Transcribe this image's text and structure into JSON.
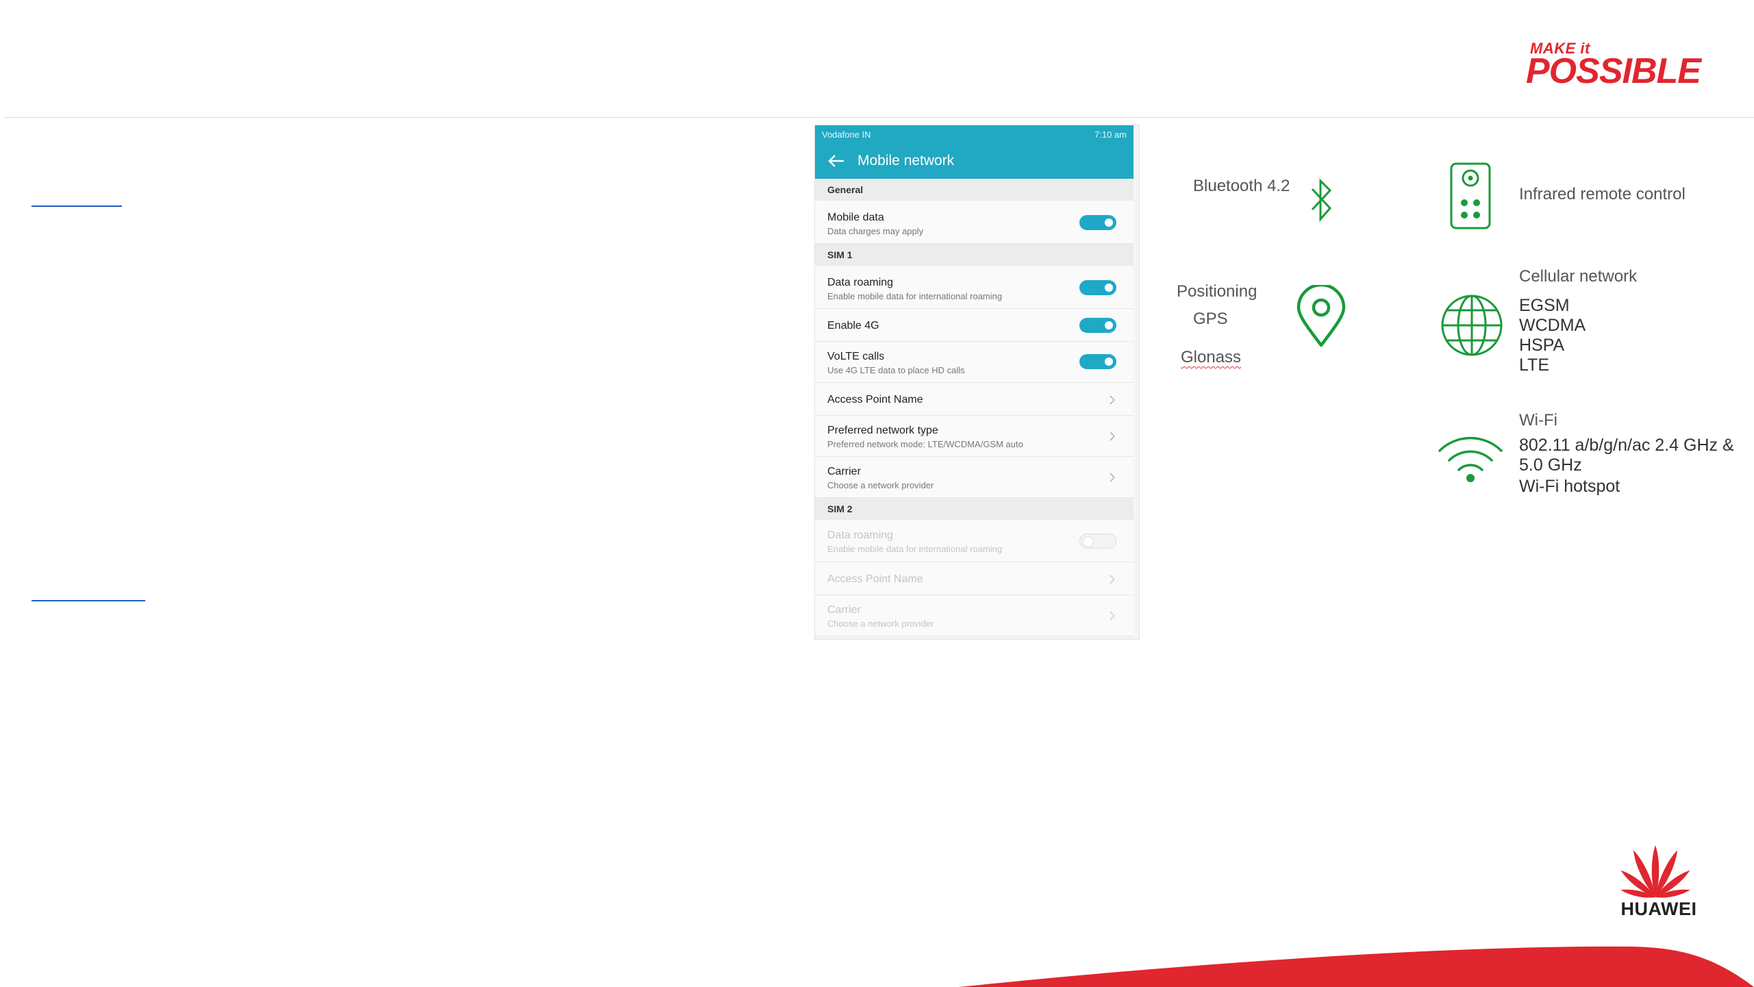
{
  "brand": {
    "slogan_top": "MAKE it",
    "slogan_bottom": "POSSIBLE",
    "logo_text": "HUAWEI",
    "accent_color": "#e0262f"
  },
  "phone": {
    "status_left": "Vodafone IN",
    "status_right": "7:10 am",
    "title": "Mobile network",
    "accent_color": "#21a8c2",
    "sections": {
      "general": "General",
      "sim1": "SIM 1",
      "sim2": "SIM 2"
    },
    "rows": {
      "mobile_data": {
        "title": "Mobile data",
        "subtitle": "Data charges may apply",
        "on": true
      },
      "data_roaming": {
        "title": "Data roaming",
        "subtitle": "Enable mobile data for international roaming",
        "on": true
      },
      "enable_4g": {
        "title": "Enable 4G",
        "on": true
      },
      "volte": {
        "title": "VoLTE calls",
        "subtitle": "Use 4G LTE data to place HD calls",
        "on": true
      },
      "apn": {
        "title": "Access Point Name"
      },
      "network_type": {
        "title": "Preferred network type",
        "subtitle": "Preferred network mode: LTE/WCDMA/GSM auto"
      },
      "carrier": {
        "title": "Carrier",
        "subtitle": "Choose a network provider"
      },
      "sim2_roaming": {
        "title": "Data roaming",
        "subtitle": "Enable mobile data for international roaming",
        "on": false
      },
      "sim2_apn": {
        "title": "Access Point Name"
      },
      "sim2_carrier": {
        "title": "Carrier",
        "subtitle": "Choose a network provider"
      }
    }
  },
  "features": {
    "bluetooth": "Bluetooth 4.2",
    "infrared": "Infrared remote control",
    "positioning": {
      "title": "Positioning",
      "gps": "GPS",
      "glonass": "Glonass"
    },
    "cellular": {
      "title": "Cellular network",
      "items": [
        "EGSM",
        "WCDMA",
        "HSPA",
        "LTE"
      ]
    },
    "wifi": {
      "title": "Wi-Fi",
      "line1": "802.11 a/b/g/n/ac 2.4 GHz &",
      "line2": "5.0 GHz",
      "line3": "Wi-Fi hotspot"
    },
    "icon_color": "#1a9a3a"
  }
}
